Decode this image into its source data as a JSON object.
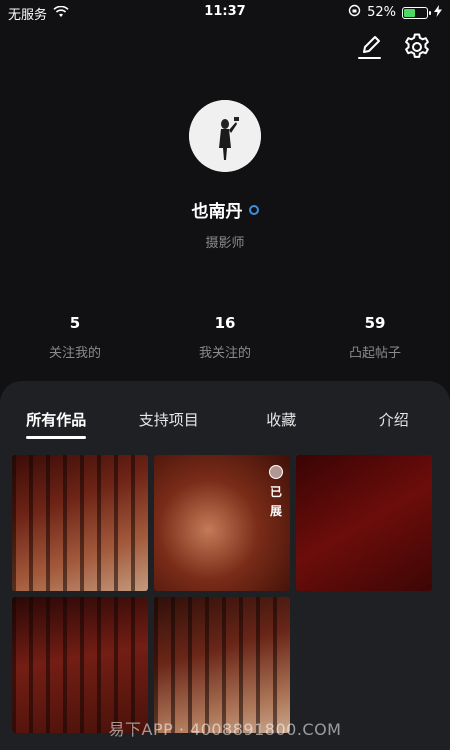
{
  "status_bar": {
    "carrier": "无服务",
    "time": "11:37",
    "battery_percent": "52%",
    "battery_level": 0.52,
    "icons": [
      "wifi-icon",
      "rotation-lock-icon",
      "battery-icon",
      "charging-icon"
    ]
  },
  "actions": {
    "edit_icon": "edit-icon",
    "settings_icon": "gear-icon"
  },
  "profile": {
    "name": "也南丹",
    "role": "摄影师",
    "verified_color": "#3d8fe0"
  },
  "stats": [
    {
      "value": "5",
      "label": "关注我的"
    },
    {
      "value": "16",
      "label": "我关注的"
    },
    {
      "value": "59",
      "label": "凸起帖子"
    }
  ],
  "tabs": [
    {
      "label": "所有作品",
      "active": true
    },
    {
      "label": "支持项目",
      "active": false
    },
    {
      "label": "收藏",
      "active": false
    },
    {
      "label": "介绍",
      "active": false
    }
  ],
  "works": [
    {
      "badge": ""
    },
    {
      "badge_chars": [
        "已",
        "展"
      ]
    },
    {
      "badge": ""
    },
    {
      "badge": ""
    },
    {
      "badge": ""
    }
  ],
  "watermark": "易下APP · 4008891800.COM",
  "colors": {
    "background": "#111113",
    "panel": "#1f2024",
    "muted_text": "#8a8a8e"
  }
}
